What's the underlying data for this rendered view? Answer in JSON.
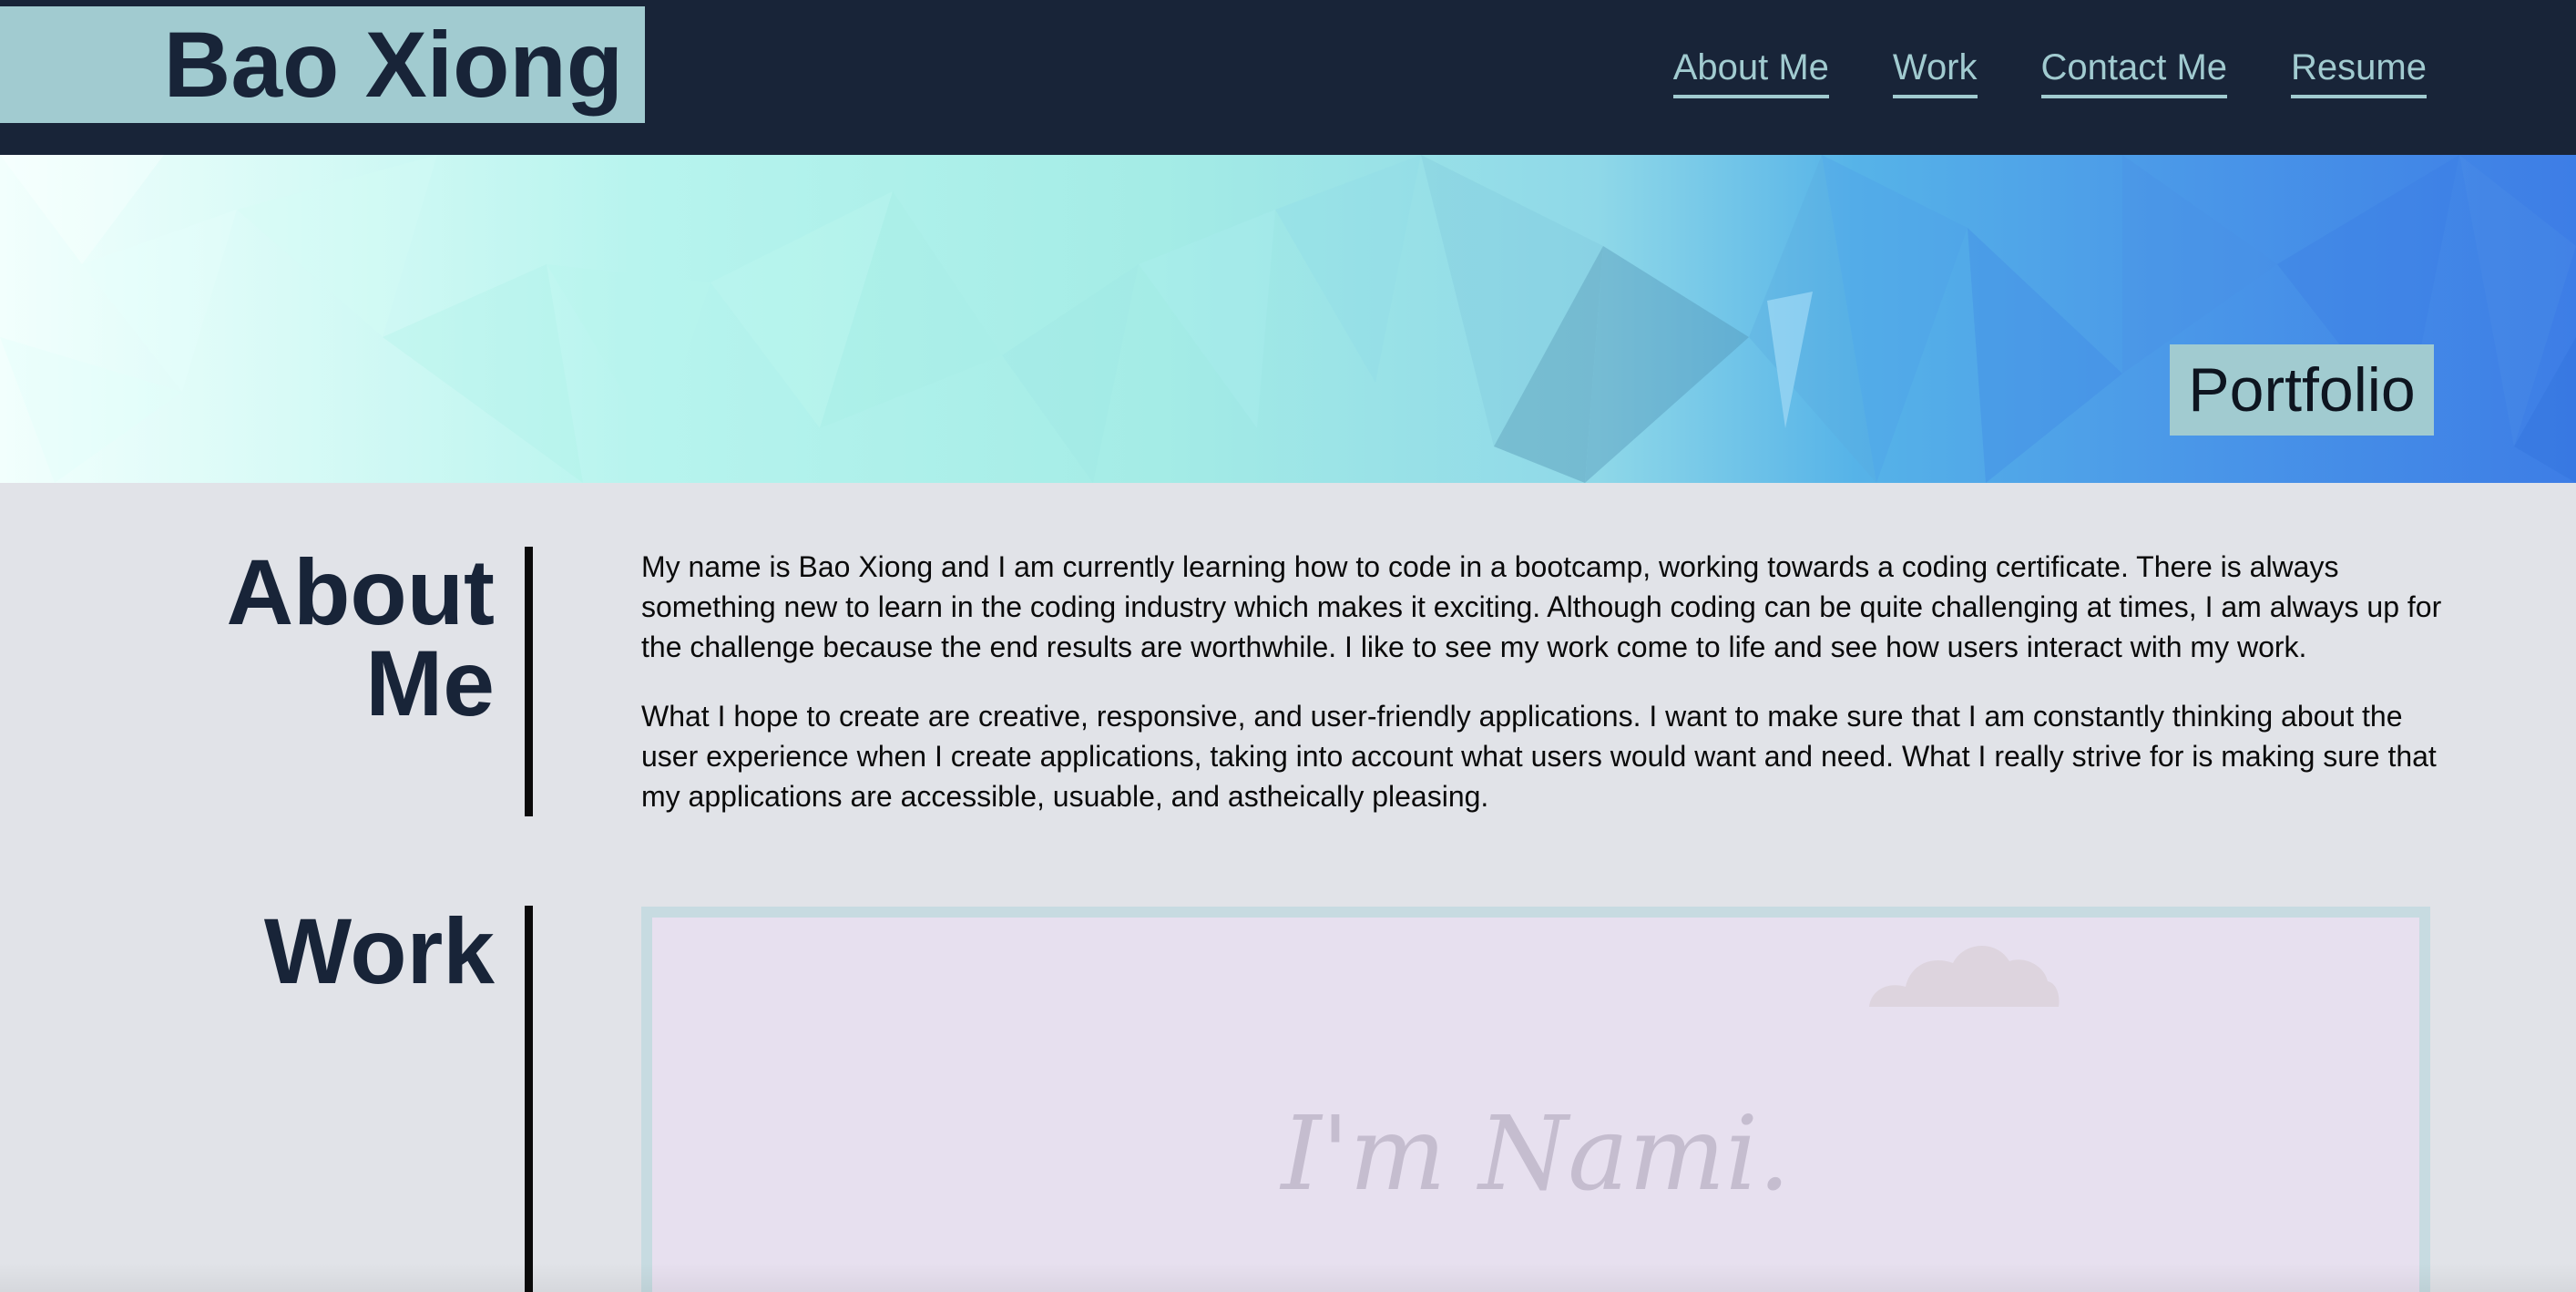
{
  "header": {
    "site_name": "Bao Xiong",
    "nav": [
      {
        "label": "About Me"
      },
      {
        "label": "Work"
      },
      {
        "label": "Contact Me"
      },
      {
        "label": "Resume"
      }
    ]
  },
  "hero": {
    "badge": "Portfolio"
  },
  "about": {
    "heading": "About Me",
    "paragraphs": [
      "My name is Bao Xiong and I am currently learning how to code in a bootcamp, working towards a coding certificate. There is always something new to learn in the coding industry which makes it exciting. Although coding can be quite challenging at times, I am always up for the challenge because the end results are worthwhile. I like to see my work come to life and see how users interact with my work.",
      "What I hope to create are creative, responsive, and user-friendly applications. I want to make sure that I am constantly thinking about the user experience when I create applications, taking into account what users would want and need. What I really strive for is making sure that my applications are accessible, usuable, and astheically pleasing."
    ]
  },
  "work": {
    "heading": "Work",
    "projects": [
      {
        "title": "I'm Nami."
      }
    ]
  },
  "colors": {
    "header_bg": "#182438",
    "accent": "#a1cbd0",
    "page_bg": "#e1e3e8",
    "text_dark": "#182438",
    "card_bg": "#e7e0ef",
    "card_border": "#c7dbe1"
  },
  "icons": {
    "cloud": "cloud-icon"
  }
}
